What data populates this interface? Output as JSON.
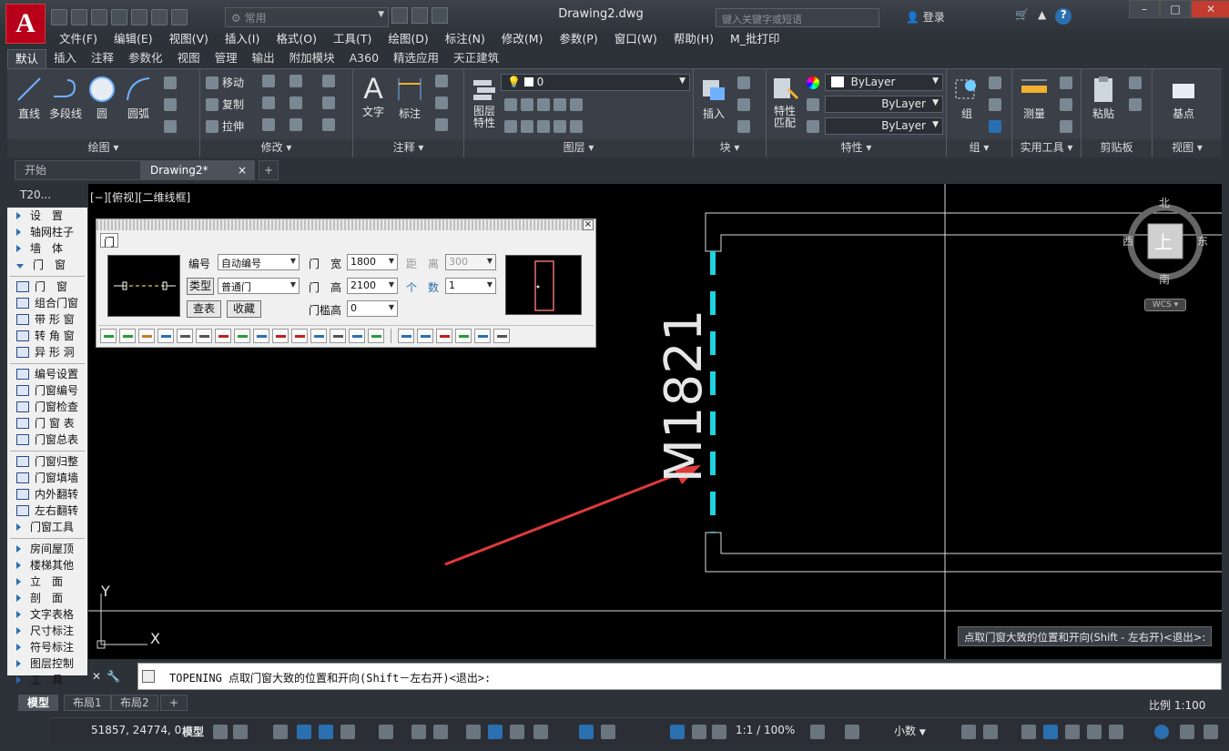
{
  "app": {
    "logo_letter": "A",
    "workspace": "常用",
    "doc_title": "Drawing2.dwg",
    "search_placeholder": "键入关键字或短语",
    "login": "登录",
    "help": "?"
  },
  "menu": [
    "文件(F)",
    "编辑(E)",
    "视图(V)",
    "插入(I)",
    "格式(O)",
    "工具(T)",
    "绘图(D)",
    "标注(N)",
    "修改(M)",
    "参数(P)",
    "窗口(W)",
    "帮助(H)",
    "M_批打印"
  ],
  "ribbon_tabs": [
    "默认",
    "插入",
    "注释",
    "参数化",
    "视图",
    "管理",
    "输出",
    "附加模块",
    "A360",
    "精选应用",
    "天正建筑"
  ],
  "ribbon_active_tab": "默认",
  "ribbon": {
    "draw": {
      "title": "绘图 ▾",
      "line": "直线",
      "polyline": "多段线",
      "circle": "圆",
      "arc": "圆弧"
    },
    "modify": {
      "title": "修改 ▾",
      "move": "移动",
      "copy": "复制",
      "stretch": "拉伸"
    },
    "annotation": {
      "title": "注释 ▾",
      "text": "文字",
      "dimension": "标注"
    },
    "layers": {
      "title": "图层 ▾",
      "props": "图层\n特性",
      "current": "0"
    },
    "block": {
      "title": "块 ▾",
      "insert": "插入"
    },
    "properties": {
      "title": "特性 ▾",
      "match": "特性\n匹配",
      "color": "ByLayer",
      "linetype": "ByLayer",
      "lineweight": "ByLayer"
    },
    "groups": {
      "title": "组 ▾",
      "group": "组"
    },
    "utilities": {
      "title": "实用工具 ▾",
      "measure": "测量"
    },
    "clipboard": {
      "title": "剪贴板",
      "paste": "粘贴"
    },
    "view": {
      "title": "视图 ▾",
      "base": "基点"
    }
  },
  "doc_tabs": {
    "start": "开始",
    "current": "Drawing2*",
    "close": "×",
    "add": "+"
  },
  "viewport_label": "[−][俯视][二维线框]",
  "viewcube": {
    "north": "北",
    "south": "南",
    "east": "东",
    "west": "西",
    "top": "上",
    "wcs": "WCS ▾"
  },
  "ucs": {
    "x": "X",
    "y": "Y"
  },
  "door_tag": "M1821",
  "sidebar": {
    "header": "T20...",
    "items": [
      {
        "label": "设　置",
        "kind": "tri"
      },
      {
        "label": "轴网柱子",
        "kind": "tri"
      },
      {
        "label": "墙　体",
        "kind": "tri"
      },
      {
        "label": "门　窗",
        "kind": "tri-down"
      },
      {
        "label": "门　窗",
        "kind": "icon"
      },
      {
        "label": "组合门窗",
        "kind": "icon"
      },
      {
        "label": "带 形 窗",
        "kind": "icon"
      },
      {
        "label": "转 角 窗",
        "kind": "icon"
      },
      {
        "label": "异 形 洞",
        "kind": "icon"
      },
      {
        "label": "编号设置",
        "kind": "icon"
      },
      {
        "label": "门窗编号",
        "kind": "icon"
      },
      {
        "label": "门窗检查",
        "kind": "icon"
      },
      {
        "label": "门 窗 表",
        "kind": "icon"
      },
      {
        "label": "门窗总表",
        "kind": "icon"
      },
      {
        "label": "门窗归整",
        "kind": "icon"
      },
      {
        "label": "门窗填墙",
        "kind": "icon"
      },
      {
        "label": "内外翻转",
        "kind": "icon"
      },
      {
        "label": "左右翻转",
        "kind": "icon"
      },
      {
        "label": "门窗工具",
        "kind": "tri"
      },
      {
        "label": "房间屋顶",
        "kind": "tri"
      },
      {
        "label": "楼梯其他",
        "kind": "tri"
      },
      {
        "label": "立　面",
        "kind": "tri"
      },
      {
        "label": "剖　面",
        "kind": "tri"
      },
      {
        "label": "文字表格",
        "kind": "tri"
      },
      {
        "label": "尺寸标注",
        "kind": "tri"
      },
      {
        "label": "符号标注",
        "kind": "tri"
      },
      {
        "label": "图层控制",
        "kind": "tri"
      },
      {
        "label": "工　具",
        "kind": "tri"
      }
    ]
  },
  "door_dialog": {
    "tab": "门",
    "number_label": "编号",
    "number_value": "自动编号",
    "type_button": "类型",
    "type_value": "普通门",
    "lookup_button": "查表",
    "favorite_button": "收藏",
    "width_label": "门　宽",
    "width_value": "1800",
    "height_label": "门　高",
    "height_value": "2100",
    "sill_label": "门槛高",
    "sill_value": "0",
    "distance_label": "距　离",
    "distance_value": "300",
    "count_label": "个　数",
    "count_value": "1",
    "close": "×"
  },
  "command": {
    "text": "TOPENING 点取门窗大致的位置和开向(Shift－左右开)<退出>:",
    "tooltip": "点取门窗大致的位置和开向(Shift - 左右开)<退出>:"
  },
  "layout_tabs": [
    "模型",
    "布局1",
    "布局2",
    "+"
  ],
  "status": {
    "coords": "51857, 24774, 0",
    "model": "模型",
    "scale": "1:1 / 100%",
    "units": "小数",
    "ratio": "比例 1:100"
  },
  "colors": {
    "accent_cyan": "#1fd3e0",
    "arrow_red": "#e0393a",
    "logo_red": "#b8001a"
  }
}
